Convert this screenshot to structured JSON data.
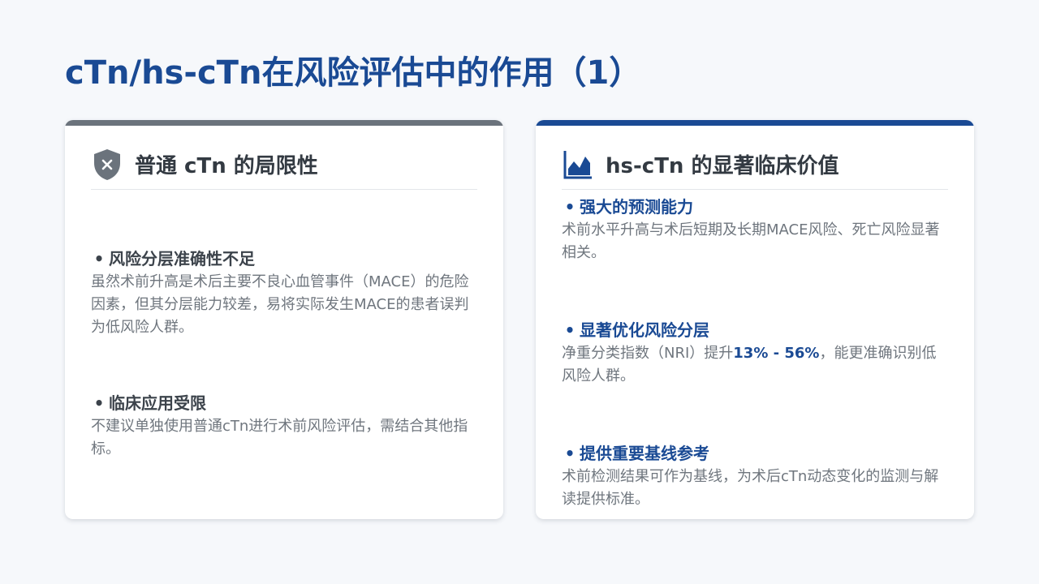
{
  "title": "cTn/hs-cTn在风险评估中的作用（1）",
  "colors": {
    "primary": "#1a4a94",
    "grey_bar": "#6b737c",
    "heading_dark": "#333a42",
    "body_text": "#6f767e",
    "background": "#f6f8fb"
  },
  "left_card": {
    "icon": "shield-x-icon",
    "title": "普通 cTn 的局限性",
    "items": [
      {
        "bullet": "•",
        "heading": "风险分层准确性不足",
        "body": "虽然术前升高是术后主要不良心血管事件（MACE）的危险因素，但其分层能力较差，易将实际发生MACE的患者误判为低风险人群。"
      },
      {
        "bullet": "•",
        "heading": "临床应用受限",
        "body": "不建议单独使用普通cTn进行术前风险评估，需结合其他指标。"
      }
    ]
  },
  "right_card": {
    "icon": "area-chart-icon",
    "title": "hs-cTn 的显著临床价值",
    "items": [
      {
        "bullet": "•",
        "heading": "强大的预测能力",
        "body": "术前水平升高与术后短期及长期MACE风险、死亡风险显著相关。"
      },
      {
        "bullet": "•",
        "heading": "显著优化风险分层",
        "body_prefix": "净重分类指数（NRI）提升",
        "body_highlight": "13% - 56%",
        "body_suffix": "，能更准确识别低风险人群。"
      },
      {
        "bullet": "•",
        "heading": "提供重要基线参考",
        "body": "术前检测结果可作为基线，为术后cTn动态变化的监测与解读提供标准。"
      }
    ]
  }
}
